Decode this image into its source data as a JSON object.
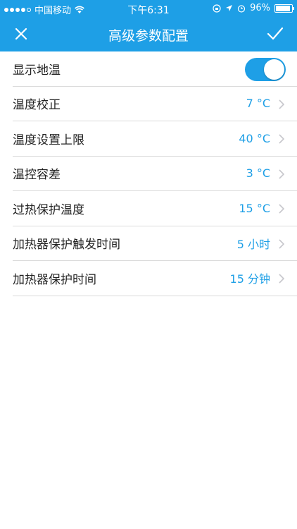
{
  "colors": {
    "accent": "#1e9fe6",
    "divider": "#dadada",
    "text": "#222222"
  },
  "status_bar": {
    "carrier": "中国移动",
    "time": "下午6:31",
    "battery": "96%"
  },
  "navbar": {
    "title": "高级参数配置",
    "close_icon": "close-icon",
    "done_icon": "check-icon"
  },
  "settings": {
    "show_floor_temp": {
      "label": "显示地温",
      "enabled": true
    },
    "temp_calibration": {
      "label": "温度校正",
      "value": "7 °C"
    },
    "temp_upper_limit": {
      "label": "温度设置上限",
      "value": "40 °C"
    },
    "temp_tolerance": {
      "label": "温控容差",
      "value": "3 °C"
    },
    "overheat_protect_temp": {
      "label": "过热保护温度",
      "value": "15 °C"
    },
    "heater_trigger_time": {
      "label": "加热器保护触发时间",
      "value": "5 小时"
    },
    "heater_protect_time": {
      "label": "加热器保护时间",
      "value": "15 分钟"
    }
  }
}
